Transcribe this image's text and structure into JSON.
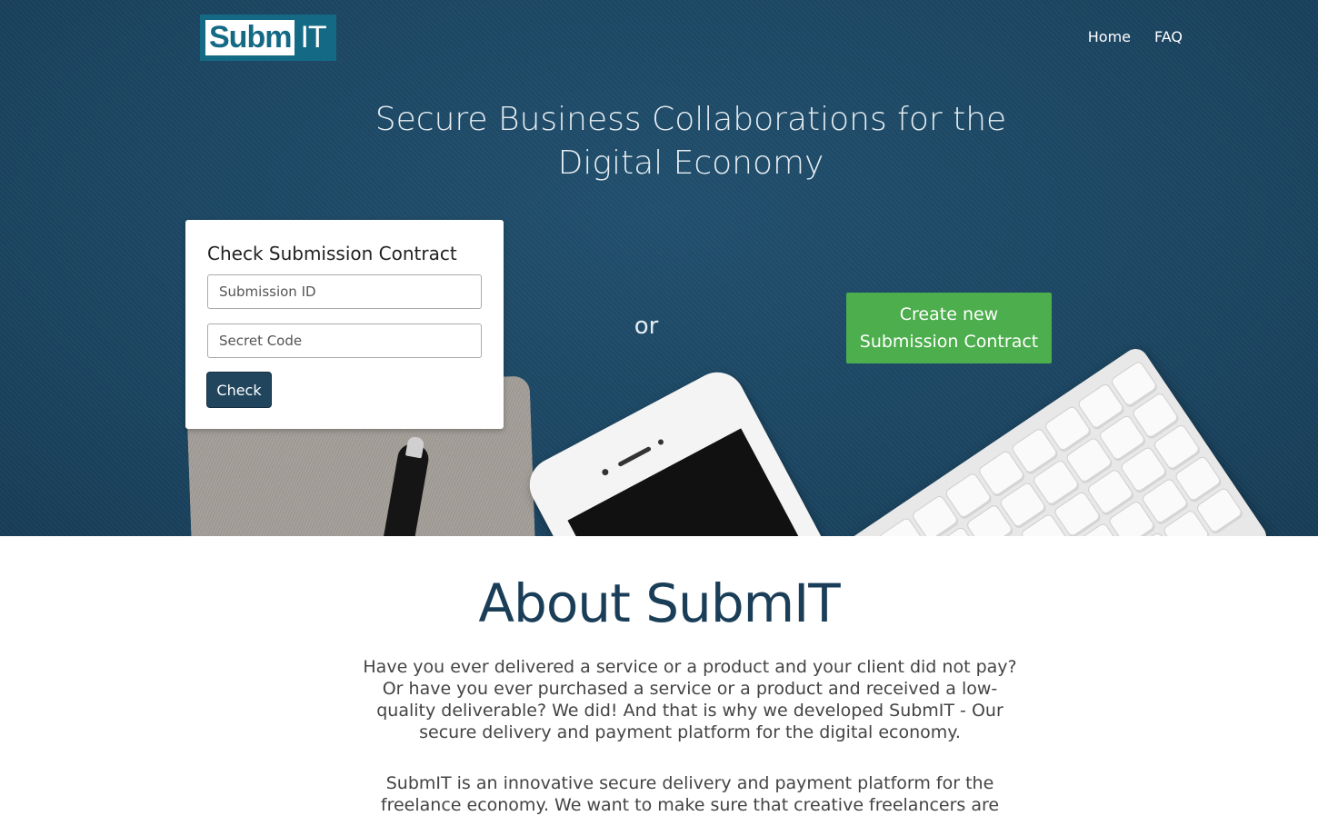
{
  "header": {
    "logo": {
      "part1": "Subm",
      "part2": "IT"
    },
    "nav": [
      {
        "label": "Home"
      },
      {
        "label": "FAQ"
      }
    ]
  },
  "hero": {
    "headline_line1": "Secure Business Collaborations for the",
    "headline_line2": "Digital Economy",
    "check_card": {
      "title": "Check Submission Contract",
      "submission_id_placeholder": "Submission ID",
      "secret_code_placeholder": "Secret Code",
      "check_label": "Check"
    },
    "or_text": "or",
    "create_button": {
      "line1": "Create new",
      "line2": "Submission Contract"
    }
  },
  "about": {
    "title": "About SubmIT",
    "paragraph1": "Have you ever delivered a service or a product and your client did not pay? Or have you ever purchased a service or a product and received a low-quality deliverable? We did! And that is why we developed SubmIT - Our secure delivery and payment platform for the digital economy.",
    "paragraph2": "SubmIT is an innovative secure delivery and payment platform for the freelance economy. We want to make sure that creative freelancers are"
  },
  "colors": {
    "hero_background": "#1e4763",
    "logo_teal": "#146a85",
    "check_button": "#22455e",
    "create_button": "#4cae4c",
    "about_title": "#1b3e58"
  }
}
